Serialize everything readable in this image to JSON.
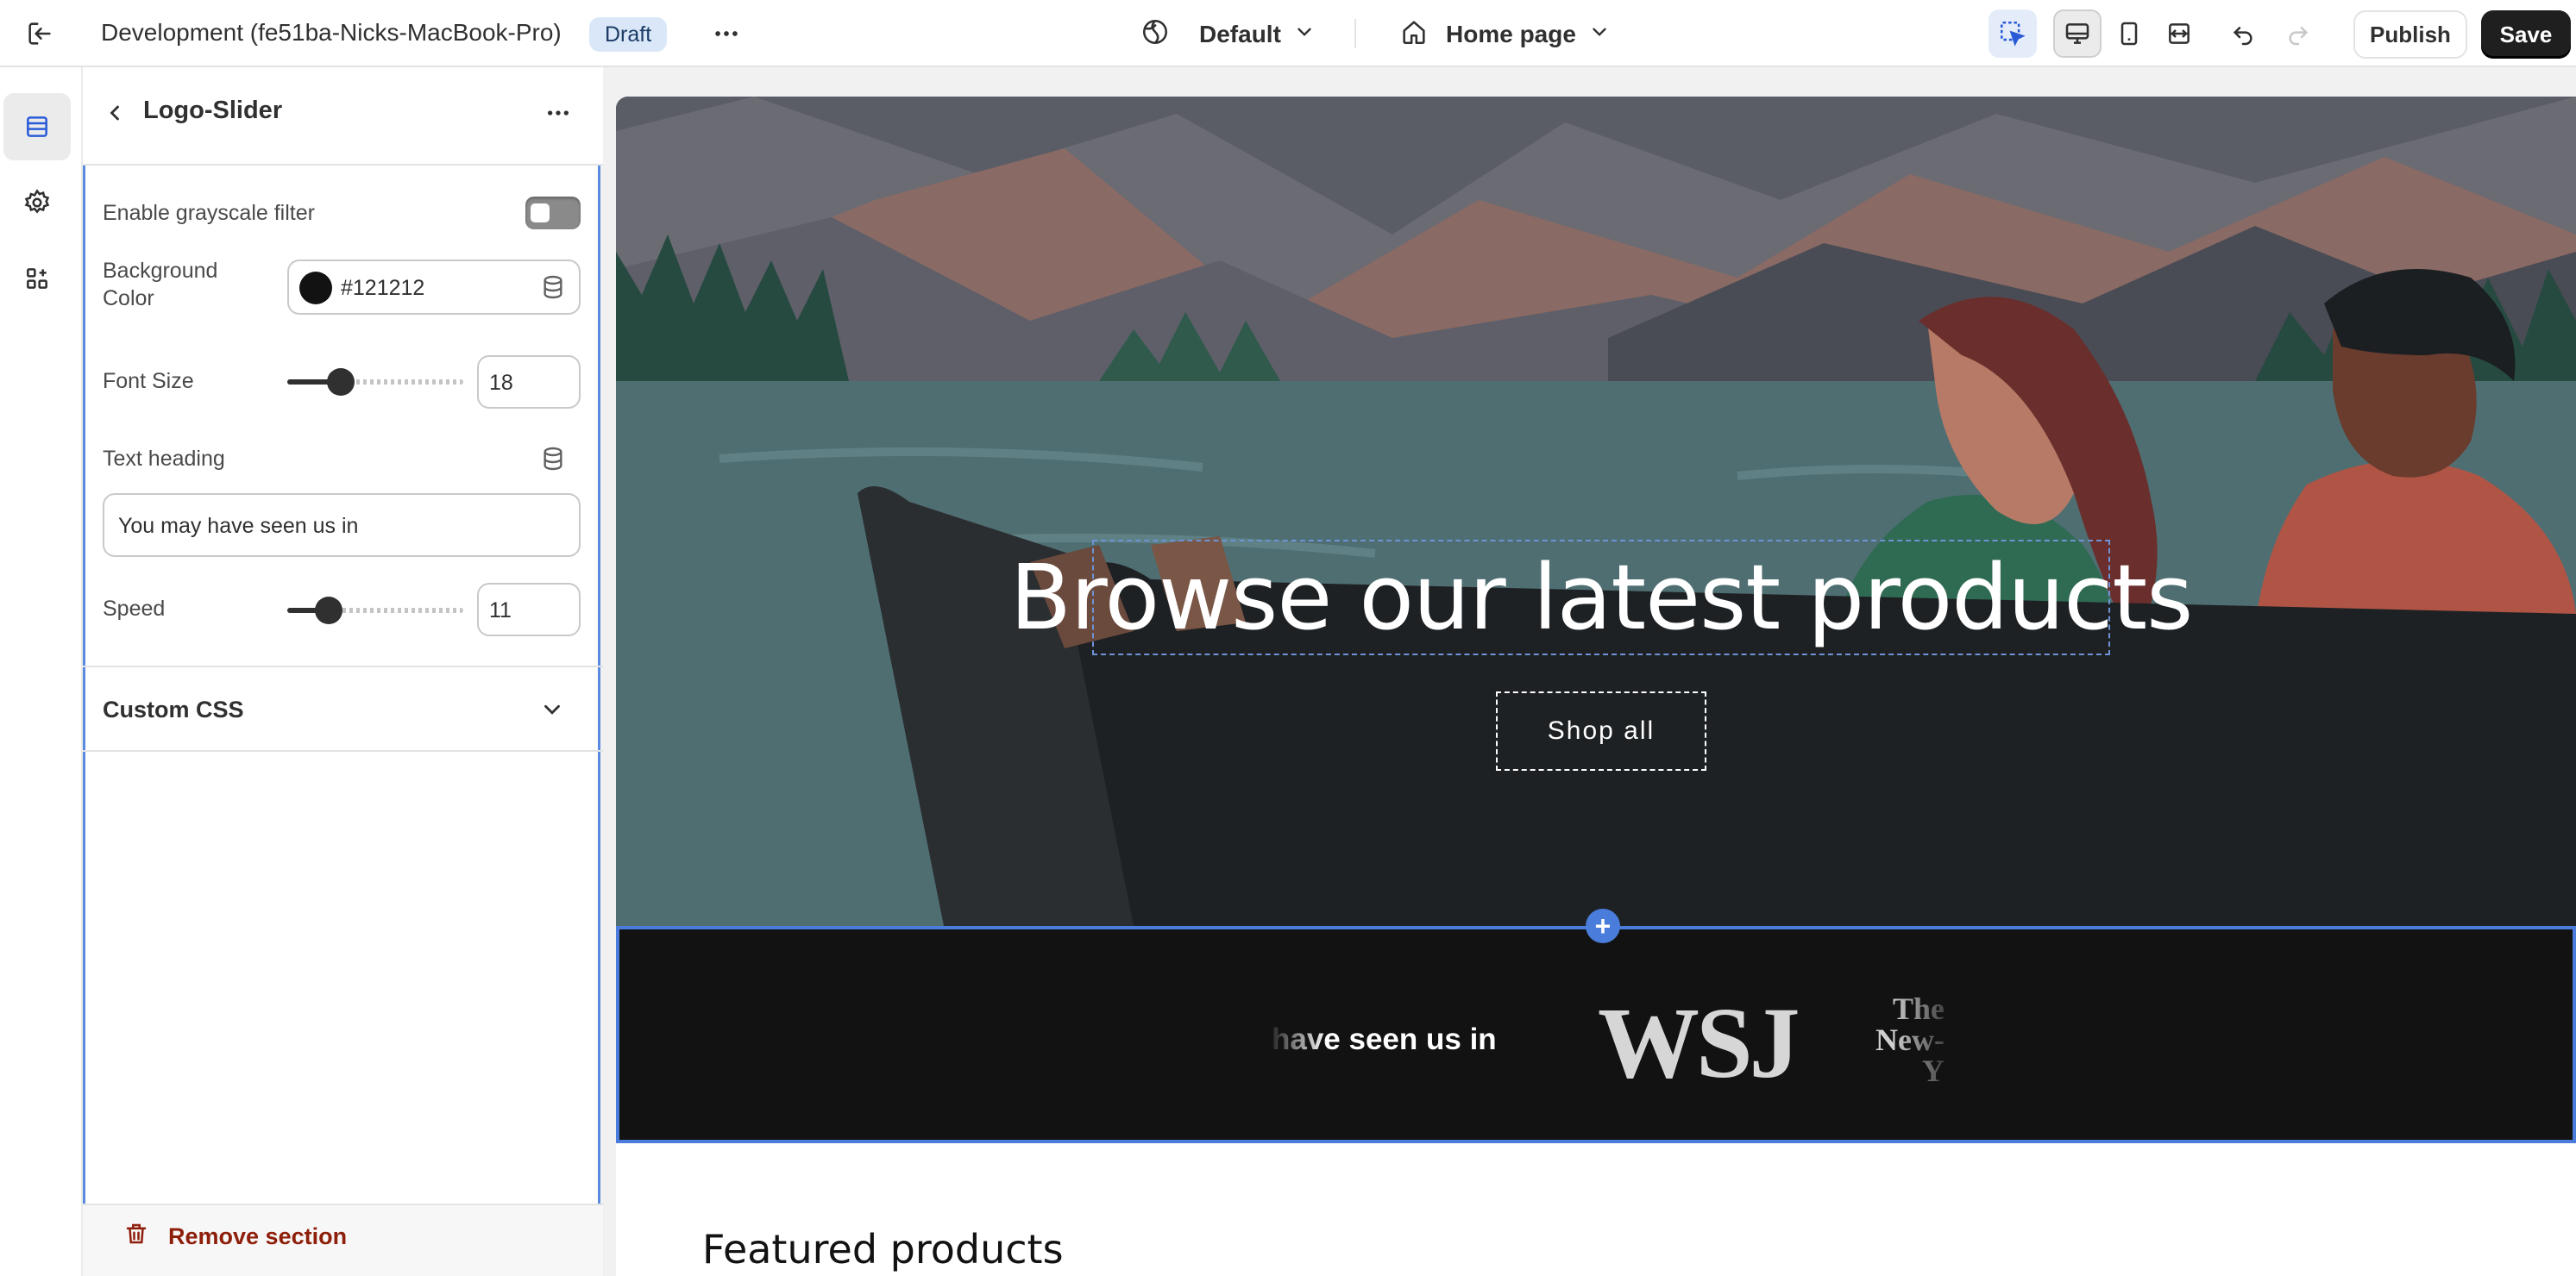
{
  "topbar": {
    "store_name": "Development (fe51ba-Nicks-MacBook-Pro)",
    "status_badge": "Draft",
    "theme_select": "Default",
    "page_select": "Home page",
    "publish_label": "Publish",
    "save_label": "Save",
    "icons": [
      "exit-icon",
      "more-horizontal-icon",
      "globe-icon",
      "chevron-down-icon",
      "home-icon",
      "inspector-icon",
      "desktop-icon",
      "mobile-icon",
      "fullwidth-icon",
      "undo-icon",
      "redo-icon"
    ]
  },
  "rail": {
    "items": [
      {
        "name": "sections-icon",
        "active": true
      },
      {
        "name": "theme-settings-icon",
        "active": false
      },
      {
        "name": "apps-icon",
        "active": false
      }
    ]
  },
  "panel": {
    "title": "Logo-Slider",
    "grayscale_label": "Enable grayscale filter",
    "grayscale_enabled": false,
    "background_color_label": "Background Color",
    "background_color_value": "#121212",
    "font_size_label": "Font Size",
    "font_size_value": "18",
    "text_heading_label": "Text heading",
    "text_heading_value": "You may have seen us in",
    "speed_label": "Speed",
    "speed_value": "11",
    "custom_css_label": "Custom CSS",
    "remove_section_label": "Remove section",
    "accent_color": "#4a7ddb",
    "danger_color": "#8e1f0b"
  },
  "preview": {
    "hero_heading": "Browse our latest products",
    "hero_button": "Shop all",
    "logo_heading_visible": "have seen us in",
    "logos": [
      "WSJ",
      "The New York Times"
    ],
    "wsj_text": "WSJ",
    "nyt_text": "The\nNew-Y\nTim",
    "featured_heading": "Featured products",
    "strip_background": "#121212"
  }
}
